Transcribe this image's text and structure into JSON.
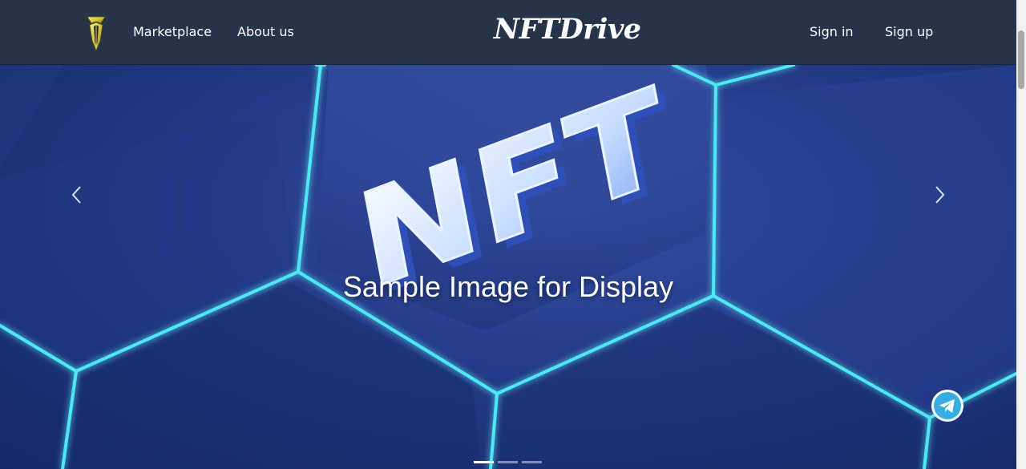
{
  "navbar": {
    "links": [
      {
        "label": "Marketplace"
      },
      {
        "label": "About us"
      }
    ],
    "brand": "NFTDrive",
    "auth": [
      {
        "label": "Sign in"
      },
      {
        "label": "Sign up"
      }
    ]
  },
  "hero": {
    "caption": "Sample Image for Display",
    "artwork_text": "NFT",
    "slide_count": 3,
    "active_slide": 1
  },
  "colors": {
    "navbar_bg": "#26344a",
    "hero_dark": "#142868",
    "hero_light": "#3651a6",
    "neon_cyan": "#4fe6f5",
    "telegram_blue": "#37aee2"
  },
  "icons": {
    "logo": "nftdrive-logo",
    "prev": "chevron-left-icon",
    "next": "chevron-right-icon",
    "chat": "telegram-icon"
  }
}
